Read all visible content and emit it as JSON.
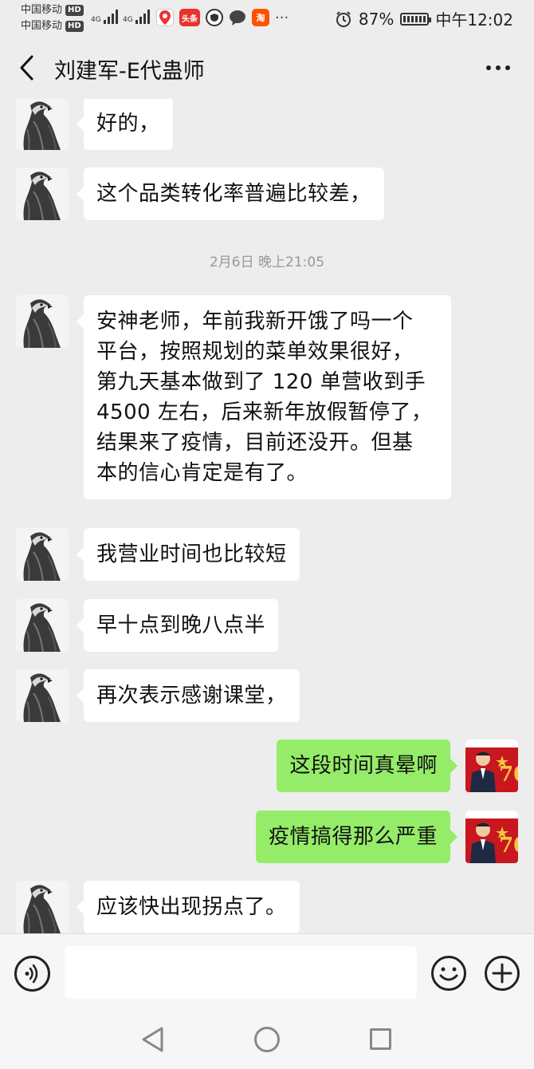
{
  "status_bar": {
    "carrier1": "中国移动",
    "carrier2": "中国移动",
    "hd": "HD",
    "network": "4G",
    "app_icons": [
      "Hotmap-icon",
      "toutiao-icon",
      "shield-app-icon",
      "chat-app-icon",
      "taobao-icon"
    ],
    "toutiao_label": "头条",
    "taobao_label": "淘",
    "more": "···",
    "battery": "87%",
    "time": "中午12:02"
  },
  "header": {
    "title": "刘建军-E代蛊师"
  },
  "messages": [
    {
      "dir": "in",
      "text": "好的，"
    },
    {
      "dir": "in",
      "text": "这个品类转化率普遍比较差，"
    },
    {
      "dir": "in",
      "text": "安神老师，年前我新开饿了吗一个\n平台，按照规划的菜单效果很好，\n第九天基本做到了 120 单营收到手\n4500 左右，后来新年放假暂停了，\n结果来了疫情，目前还没开。但基\n本的信心肯定是有了。"
    },
    {
      "dir": "in",
      "text": "我营业时间也比较短"
    },
    {
      "dir": "in",
      "text": "早十点到晚八点半"
    },
    {
      "dir": "in",
      "text": "再次表示感谢课堂，"
    },
    {
      "dir": "out",
      "text": "这段时间真晕啊"
    },
    {
      "dir": "out",
      "text": "疫情搞得那么严重"
    },
    {
      "dir": "in",
      "text": "应该快出现拐点了。"
    }
  ],
  "timestamp": "2月6日 晚上21:05",
  "input": {
    "placeholder": "",
    "value": ""
  },
  "colors": {
    "background": "#ededed",
    "incoming_bubble": "#ffffff",
    "outgoing_bubble": "#95ec69",
    "timestamp": "#999999"
  }
}
